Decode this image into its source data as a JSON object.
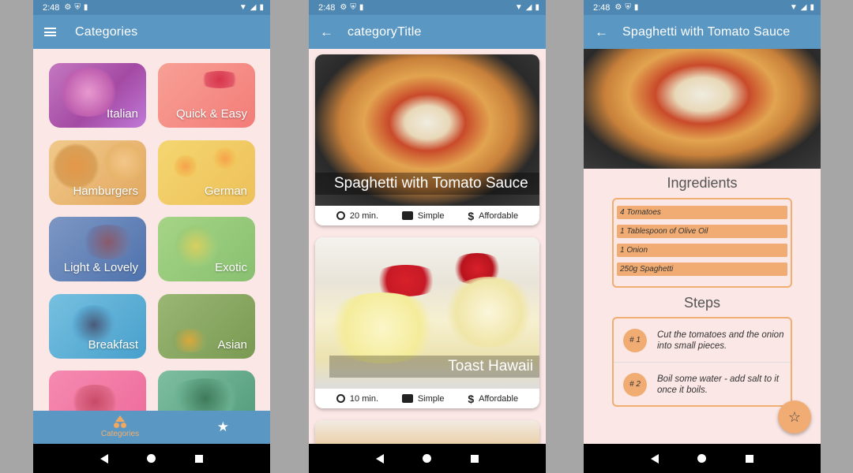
{
  "status": {
    "time": "2:48"
  },
  "screen1": {
    "title": "Categories",
    "categories": [
      {
        "label": "Italian",
        "color": "#b25ab0"
      },
      {
        "label": "Quick & Easy",
        "color": "#f48d82"
      },
      {
        "label": "Hamburgers",
        "color": "#e8b870"
      },
      {
        "label": "German",
        "color": "#f2cc66"
      },
      {
        "label": "Light & Lovely",
        "color": "#5f81b8"
      },
      {
        "label": "Exotic",
        "color": "#93c97e"
      },
      {
        "label": "Breakfast",
        "color": "#5bb0d6"
      },
      {
        "label": "Asian",
        "color": "#86a860"
      },
      {
        "label": "",
        "color": "#f06ea0"
      },
      {
        "label": "",
        "color": "#5ea88c"
      }
    ],
    "tabs": [
      {
        "label": "Categories",
        "icon": "category-icon"
      },
      {
        "label": "",
        "icon": "star-icon"
      }
    ]
  },
  "screen2": {
    "title": "categoryTitle",
    "meals": [
      {
        "title": "Spaghetti with Tomato Sauce",
        "duration": "20 min.",
        "complexity": "Simple",
        "affordability": "Affordable"
      },
      {
        "title": "Toast Hawaii",
        "duration": "10 min.",
        "complexity": "Simple",
        "affordability": "Affordable"
      }
    ]
  },
  "screen3": {
    "title": "Spaghetti with Tomato Sauce",
    "ingredients_heading": "Ingredients",
    "ingredients": [
      "4 Tomatoes",
      "1 Tablespoon of Olive Oil",
      "1 Onion",
      "250g Spaghetti"
    ],
    "steps_heading": "Steps",
    "steps": [
      {
        "num": "# 1",
        "text": "Cut the tomatoes and the onion into small pieces."
      },
      {
        "num": "# 2",
        "text": "Boil some water - add salt to it once it boils."
      }
    ]
  },
  "colors": {
    "appbar": "#5a97c2",
    "accent": "#f0ac72",
    "background": "#fbe7e5"
  }
}
